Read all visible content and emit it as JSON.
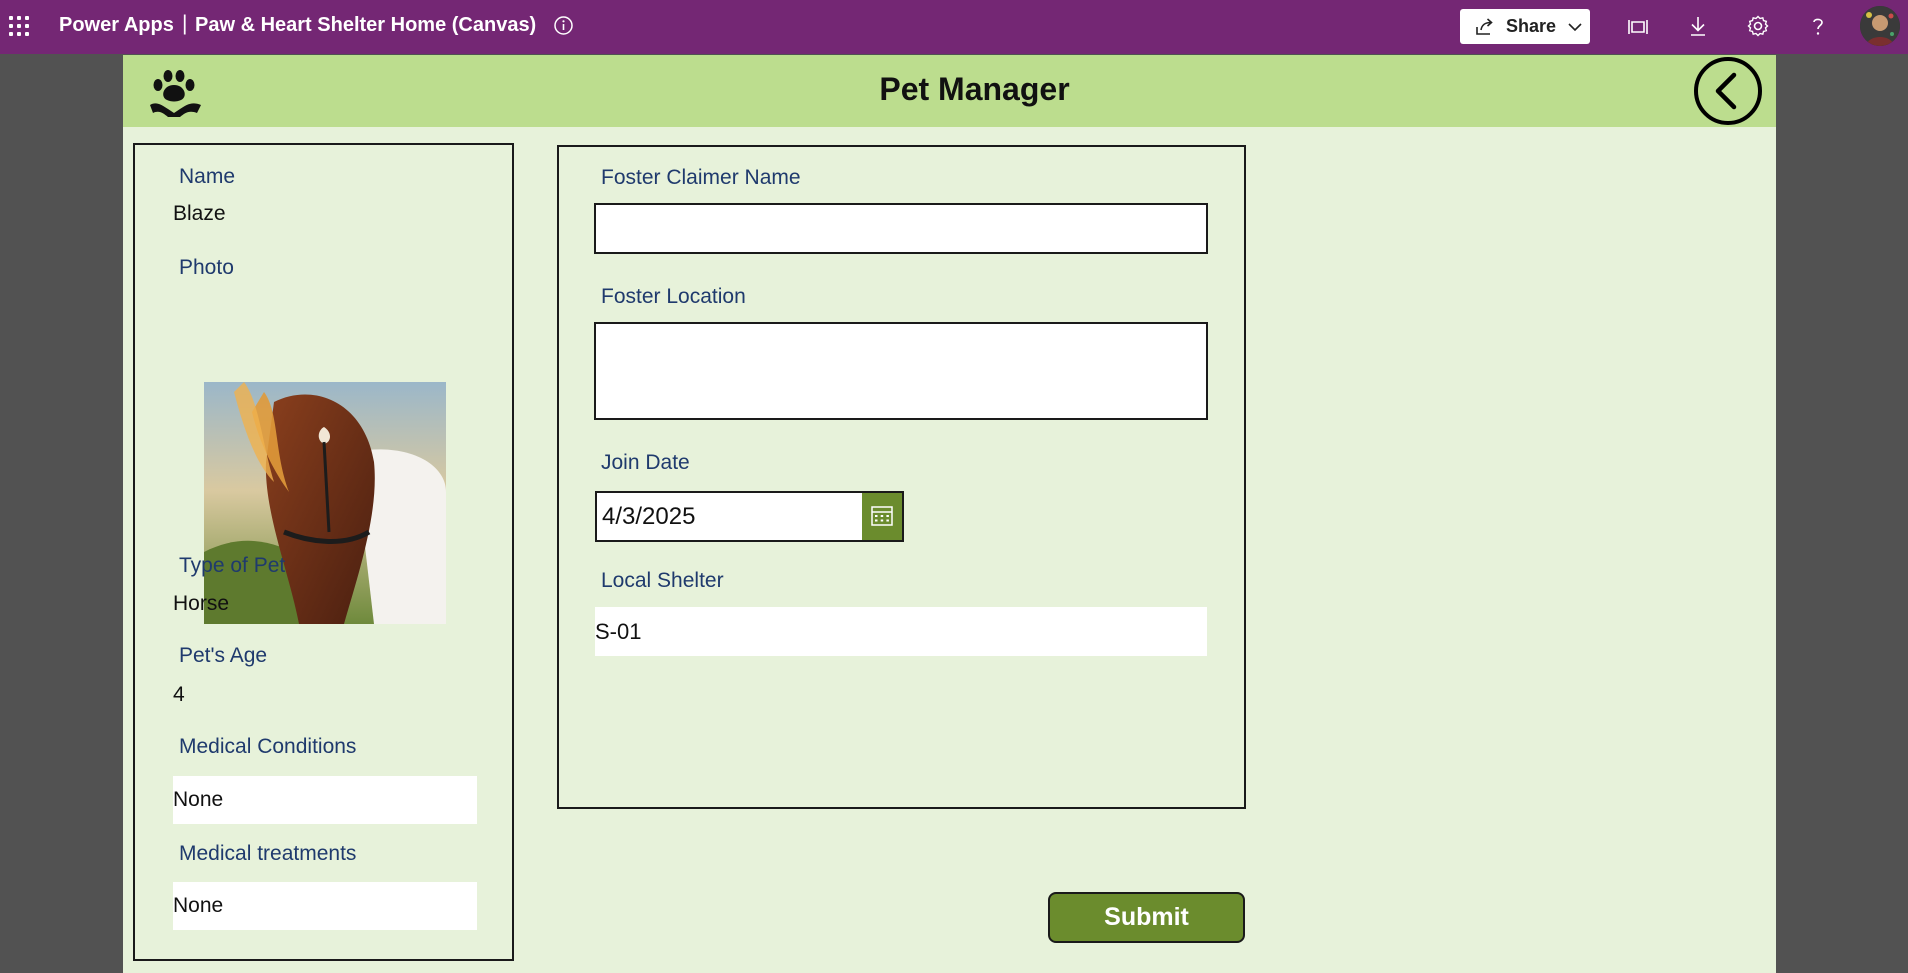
{
  "topbar": {
    "brand": "Power Apps",
    "separator": "|",
    "app_title": "Paw & Heart Shelter Home (Canvas)",
    "share_label": "Share",
    "icons": [
      "waffle-icon",
      "info-icon",
      "share-icon",
      "chevron-down-icon",
      "fit-to-screen-icon",
      "download-icon",
      "settings-icon",
      "help-icon",
      "avatar"
    ],
    "bg_color": "#742774"
  },
  "app": {
    "title": "Pet Manager",
    "header_color": "#bcdd8e",
    "canvas_color": "#e7f2da",
    "accent_color": "#6b8c2d"
  },
  "pet": {
    "name_label": "Name",
    "name": "Blaze",
    "photo_label": "Photo",
    "type_label": "Type of Pet",
    "type": "Horse",
    "age_label": "Pet's Age",
    "age": "4",
    "medical_conditions_label": "Medical Conditions",
    "medical_conditions": "None",
    "medical_treatments_label": "Medical treatments",
    "medical_treatments": "None"
  },
  "form": {
    "foster_name_label": "Foster Claimer Name",
    "foster_name_value": "",
    "foster_location_label": "Foster Location",
    "foster_location_value": "",
    "join_date_label": "Join Date",
    "join_date_value": "4/3/2025",
    "local_shelter_label": "Local Shelter",
    "local_shelter_value": "S-01",
    "submit_label": "Submit"
  }
}
